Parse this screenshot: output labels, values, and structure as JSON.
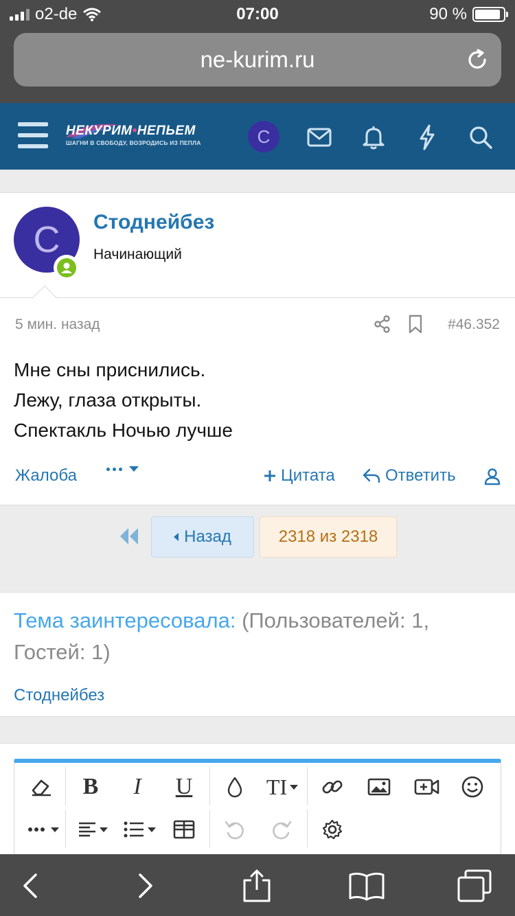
{
  "status_bar": {
    "carrier": "o2-de",
    "time": "07:00",
    "battery": "90 %",
    "battery_level": 0.9
  },
  "browser": {
    "url": "ne-kurim.ru"
  },
  "header": {
    "logo_title_1": "НЕКУРИМ",
    "logo_dot": "•",
    "logo_title_2": "НЕПЬЕМ",
    "logo_subtitle": "ШАГНИ В СВОБОДУ, ВОЗРОДИСЬ ИЗ ПЕПЛА",
    "avatar_letter": "С"
  },
  "post": {
    "avatar_letter": "С",
    "username": "Стоднейбез",
    "user_title": "Начинающий",
    "time": "5 мин. назад",
    "number": "#46.352",
    "lines": [
      "Мне сны приснились.",
      "Лежу, глаза открыты.",
      "Спектакль Ночью лучше"
    ],
    "actions": {
      "report": "Жалоба",
      "quote": "Цитата",
      "reply": "Ответить"
    }
  },
  "pagination": {
    "prev": "Назад",
    "current": "2318 из 2318"
  },
  "interested": {
    "label": "Тема заинтересовала:",
    "counts": " (Пользователей: 1, Гостей: 1)",
    "user": "Стоднейбез"
  },
  "editor_toolbar": {
    "bold": "B",
    "italic": "I",
    "underline": "U",
    "text_size": "TI"
  },
  "colors": {
    "header_bg": "#185886",
    "link": "#2577b1",
    "online": "#7cbe1e",
    "avatar_bg": "#3a2fa0",
    "page_current": "#b47014",
    "editor_accent": "#47a7eb"
  }
}
